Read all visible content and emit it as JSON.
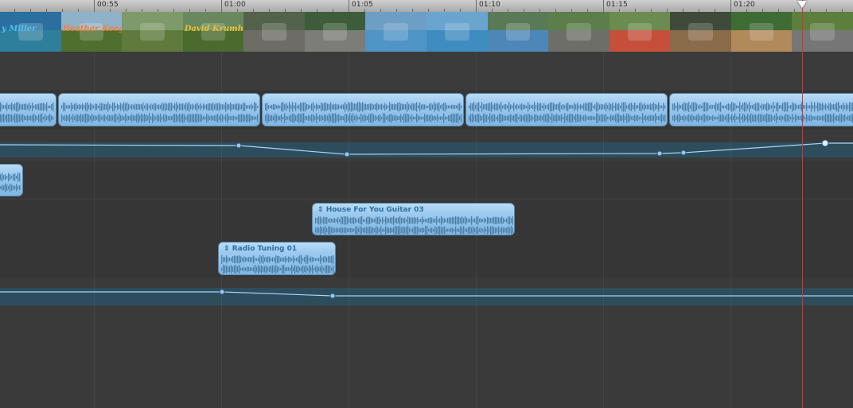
{
  "ruler": {
    "labels": [
      "00:55",
      "01:00",
      "01:05",
      "01:10",
      "01:15",
      "01:20"
    ]
  },
  "filmstrip": {
    "frames": [
      {
        "caption": "y Miller",
        "caption_color": "#4fc3f0",
        "sky": "#2b6f9e",
        "ground": "#2e7f9c"
      },
      {
        "caption": "Heather Keegan",
        "caption_color": "#ff7a2a",
        "sky": "#8fb2c8",
        "ground": "#4f6f2e"
      },
      {
        "caption": "",
        "caption_color": "#f4c02a",
        "sky": "#7f9a6a",
        "ground": "#5f7a3c"
      },
      {
        "caption": "David Krumholtz",
        "caption_color": "#e6c230",
        "sky": "#6a8860",
        "ground": "#4a6a2e"
      },
      {
        "caption": "",
        "caption_color": "",
        "sky": "#53624a",
        "ground": "#6d6d66"
      },
      {
        "caption": "",
        "caption_color": "",
        "sky": "#3d5d3a",
        "ground": "#7c7c78"
      },
      {
        "caption": "",
        "caption_color": "",
        "sky": "#6c9ec6",
        "ground": "#4f95c6"
      },
      {
        "caption": "",
        "caption_color": "",
        "sky": "#6aa5cf",
        "ground": "#3f8cc0"
      },
      {
        "caption": "",
        "caption_color": "",
        "sky": "#597a56",
        "ground": "#4d87b8"
      },
      {
        "caption": "",
        "caption_color": "",
        "sky": "#5b7e4a",
        "ground": "#6e6e69"
      },
      {
        "caption": "",
        "caption_color": "",
        "sky": "#6b8b50",
        "ground": "#c64f3a"
      },
      {
        "caption": "",
        "caption_color": "",
        "sky": "#3f4b3a",
        "ground": "#8a6b4a"
      },
      {
        "caption": "",
        "caption_color": "",
        "sky": "#3f6b34",
        "ground": "#b08a5a"
      },
      {
        "caption": "",
        "caption_color": "",
        "sky": "#5c7f3e",
        "ground": "#767676"
      }
    ]
  },
  "clips": {
    "house_for_you": "House For You Guitar 03",
    "radio_tuning": "Radio Tuning 01"
  },
  "colors": {
    "track_band": "#2e4d5c",
    "envelope_line": "#a8d4f2",
    "playhead": "#e03030"
  }
}
